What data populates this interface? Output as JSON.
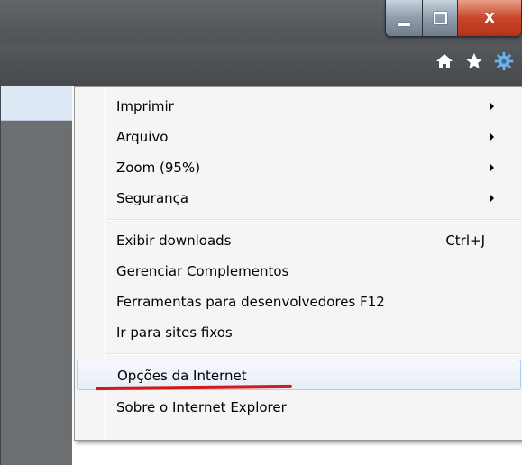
{
  "window": {
    "caption_buttons": {
      "minimize_icon": "minimize-icon",
      "maximize_icon": "maximize-icon",
      "close_label": "X"
    },
    "toolbar_icons": [
      "home-icon",
      "star-icon",
      "gear-icon"
    ]
  },
  "menu": {
    "groups": [
      [
        {
          "label": "Imprimir",
          "submenu": true
        },
        {
          "label": "Arquivo",
          "submenu": true
        },
        {
          "label": "Zoom (95%)",
          "submenu": true
        },
        {
          "label": "Segurança",
          "submenu": true
        }
      ],
      [
        {
          "label": "Exibir downloads",
          "shortcut": "Ctrl+J"
        },
        {
          "label": "Gerenciar Complementos"
        },
        {
          "label": "Ferramentas para desenvolvedores F12"
        },
        {
          "label": "Ir para sites fixos"
        }
      ],
      [
        {
          "label": "Opções da Internet",
          "highlighted": true
        },
        {
          "label": "Sobre o Internet Explorer"
        }
      ]
    ]
  },
  "colors": {
    "titlebar": "#55595c",
    "close_button": "#c9472a",
    "menu_background": "#f5f5f5",
    "annotation_underline": "#d11a1a"
  }
}
